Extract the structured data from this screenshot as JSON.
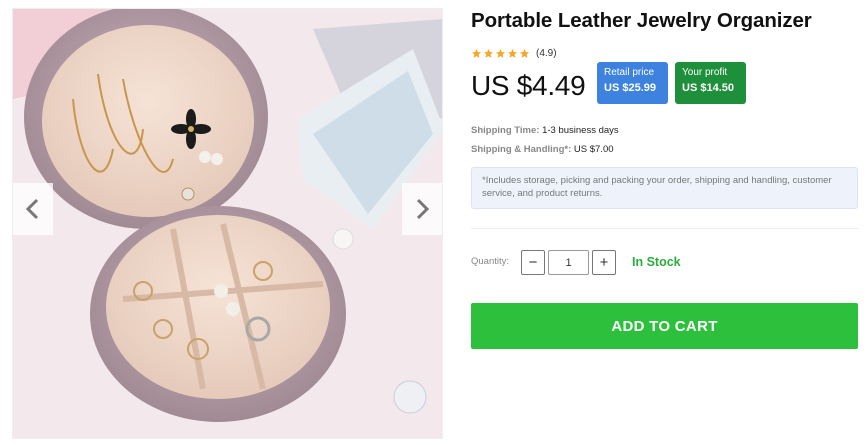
{
  "product": {
    "title": "Portable Leather Jewelry Organizer",
    "rating": 5,
    "rating_text": "(4.9)",
    "price": "US $4.49",
    "retail": {
      "label": "Retail price",
      "value": "US $25.99"
    },
    "profit": {
      "label": "Your profit",
      "value": "US $14.50"
    }
  },
  "shipping": {
    "time_label": "Shipping Time:",
    "time_value": "1-3 business days",
    "handling_label": "Shipping & Handling*:",
    "handling_value": "US $7.00",
    "note": "*Includes storage, picking and packing your order, shipping and handling, customer service, and product returns."
  },
  "quantity": {
    "label": "Quantity:",
    "minus": "−",
    "plus": "+",
    "value": "1",
    "stock_text": "In Stock"
  },
  "cart": {
    "label": "ADD TO CART"
  },
  "colors": {
    "retail_badge": "#3d82df",
    "profit_badge": "#1e8f3a",
    "stock": "#2aae3a",
    "add_to_cart": "#2cc03c",
    "star": "#f5a623"
  },
  "icons": {
    "prev": "chevron-left-icon",
    "next": "chevron-right-icon",
    "star": "star-icon"
  }
}
